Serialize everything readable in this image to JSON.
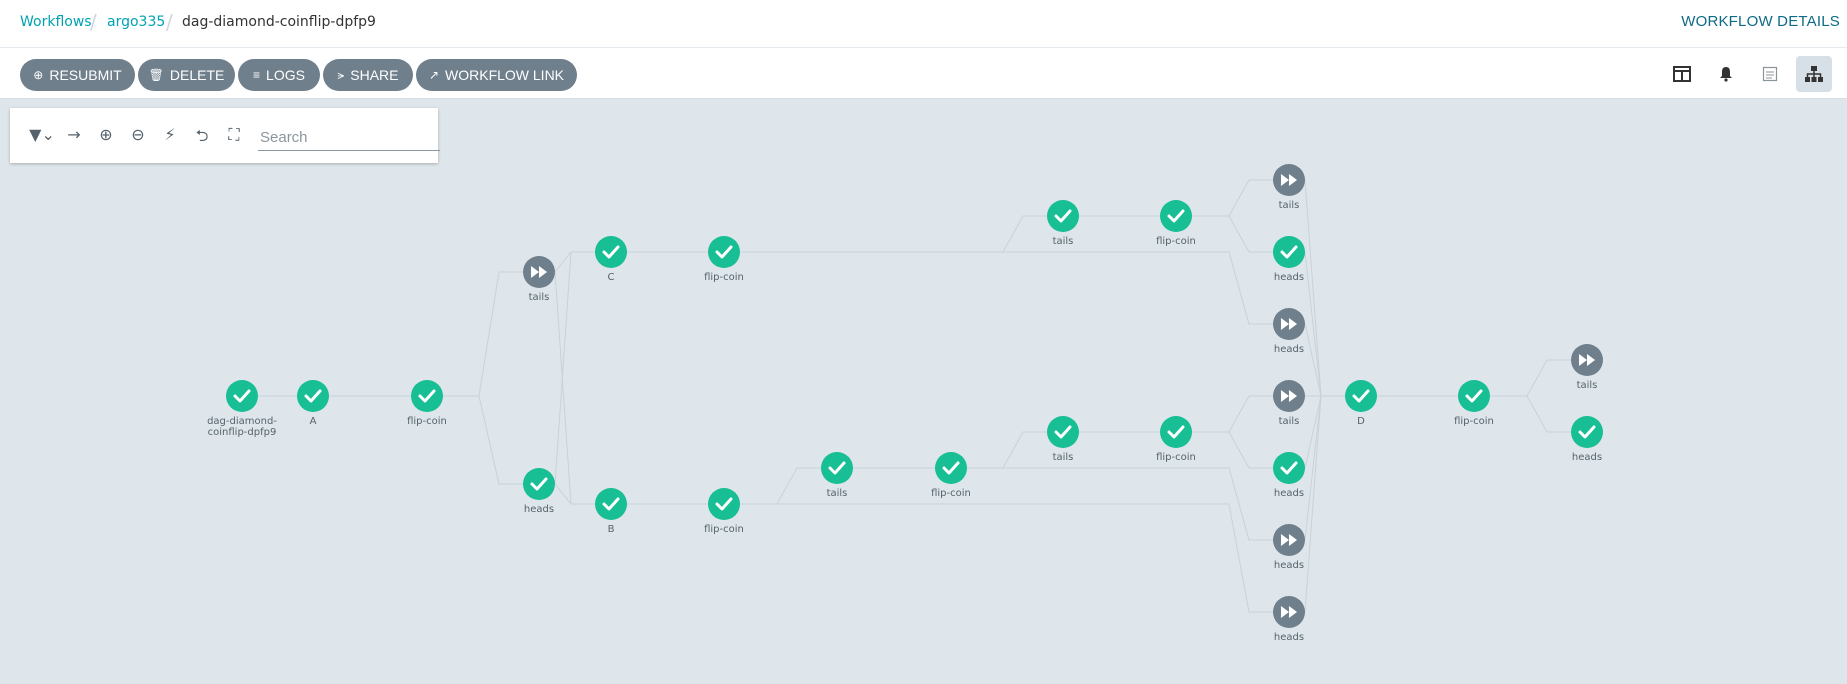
{
  "breadcrumb": {
    "items": [
      "Workflows",
      "argo335"
    ],
    "current": "dag-diamond-coinflip-dpfp9"
  },
  "page_title": "WORKFLOW DETAILS",
  "toolbar": {
    "resubmit": "RESUBMIT",
    "delete": "DELETE",
    "logs": "LOGS",
    "share": "SHARE",
    "workflow_link": "WORKFLOW LINK"
  },
  "view_buttons": [
    "layout-panel-icon",
    "bell-icon",
    "summary-icon",
    "tree-graph-icon"
  ],
  "filter": {
    "icons": [
      "filter-icon",
      "arrow-right-icon",
      "zoom-in-icon",
      "zoom-out-icon",
      "bolt-icon",
      "collapse-icon",
      "expand-icon"
    ],
    "search_placeholder": "Search"
  },
  "colors": {
    "success": "#18be94",
    "skipped": "#6f7f8c",
    "link": "#00a2b3",
    "title": "#0e6a86",
    "canvas": "#dee6eb"
  },
  "graph": {
    "nodes": [
      {
        "id": "root",
        "label": [
          "dag-diamond-",
          "coinflip-dpfp9"
        ],
        "status": "success"
      },
      {
        "id": "A",
        "label": [
          "A"
        ],
        "status": "success"
      },
      {
        "id": "fc1",
        "label": [
          "flip-coin"
        ],
        "status": "success"
      },
      {
        "id": "t1",
        "label": [
          "tails"
        ],
        "status": "skipped"
      },
      {
        "id": "h1",
        "label": [
          "heads"
        ],
        "status": "success"
      },
      {
        "id": "C",
        "label": [
          "C"
        ],
        "status": "success"
      },
      {
        "id": "B",
        "label": [
          "B"
        ],
        "status": "success"
      },
      {
        "id": "fcC",
        "label": [
          "flip-coin"
        ],
        "status": "success"
      },
      {
        "id": "fcB",
        "label": [
          "flip-coin"
        ],
        "status": "success"
      },
      {
        "id": "tB",
        "label": [
          "tails"
        ],
        "status": "success"
      },
      {
        "id": "fcB2",
        "label": [
          "flip-coin"
        ],
        "status": "success"
      },
      {
        "id": "tC",
        "label": [
          "tails"
        ],
        "status": "success"
      },
      {
        "id": "fcC2",
        "label": [
          "flip-coin"
        ],
        "status": "success"
      },
      {
        "id": "tC2",
        "label": [
          "tails"
        ],
        "status": "skipped"
      },
      {
        "id": "hC2",
        "label": [
          "heads"
        ],
        "status": "success"
      },
      {
        "id": "hC",
        "label": [
          "heads"
        ],
        "status": "skipped"
      },
      {
        "id": "tB2",
        "label": [
          "tails"
        ],
        "status": "success"
      },
      {
        "id": "fcB3",
        "label": [
          "flip-coin"
        ],
        "status": "success"
      },
      {
        "id": "tB3",
        "label": [
          "tails"
        ],
        "status": "skipped"
      },
      {
        "id": "hB3",
        "label": [
          "heads"
        ],
        "status": "success"
      },
      {
        "id": "hB2",
        "label": [
          "heads"
        ],
        "status": "skipped"
      },
      {
        "id": "hB",
        "label": [
          "heads"
        ],
        "status": "skipped"
      },
      {
        "id": "D",
        "label": [
          "D"
        ],
        "status": "success"
      },
      {
        "id": "fcD",
        "label": [
          "flip-coin"
        ],
        "status": "success"
      },
      {
        "id": "tD",
        "label": [
          "tails"
        ],
        "status": "skipped"
      },
      {
        "id": "hD",
        "label": [
          "heads"
        ],
        "status": "success"
      }
    ],
    "edges": [
      [
        "root",
        "A"
      ],
      [
        "A",
        "fc1"
      ],
      [
        "fc1",
        "t1"
      ],
      [
        "fc1",
        "h1"
      ],
      [
        "t1",
        "C"
      ],
      [
        "t1",
        "B"
      ],
      [
        "h1",
        "C"
      ],
      [
        "h1",
        "B"
      ],
      [
        "C",
        "fcC"
      ],
      [
        "B",
        "fcB"
      ],
      [
        "fcC",
        "tC"
      ],
      [
        "fcC",
        "hC"
      ],
      [
        "tC",
        "fcC2"
      ],
      [
        "fcC2",
        "tC2"
      ],
      [
        "fcC2",
        "hC2"
      ],
      [
        "fcB",
        "tB"
      ],
      [
        "fcB",
        "hB"
      ],
      [
        "tB",
        "fcB2"
      ],
      [
        "fcB2",
        "tB2"
      ],
      [
        "fcB2",
        "hB2"
      ],
      [
        "tB2",
        "fcB3"
      ],
      [
        "fcB3",
        "tB3"
      ],
      [
        "fcB3",
        "hB3"
      ],
      [
        "tC2",
        "D"
      ],
      [
        "hC2",
        "D"
      ],
      [
        "hC",
        "D"
      ],
      [
        "tB3",
        "D"
      ],
      [
        "hB3",
        "D"
      ],
      [
        "hB2",
        "D"
      ],
      [
        "hB",
        "D"
      ],
      [
        "D",
        "fcD"
      ],
      [
        "fcD",
        "tD"
      ],
      [
        "fcD",
        "hD"
      ]
    ]
  }
}
